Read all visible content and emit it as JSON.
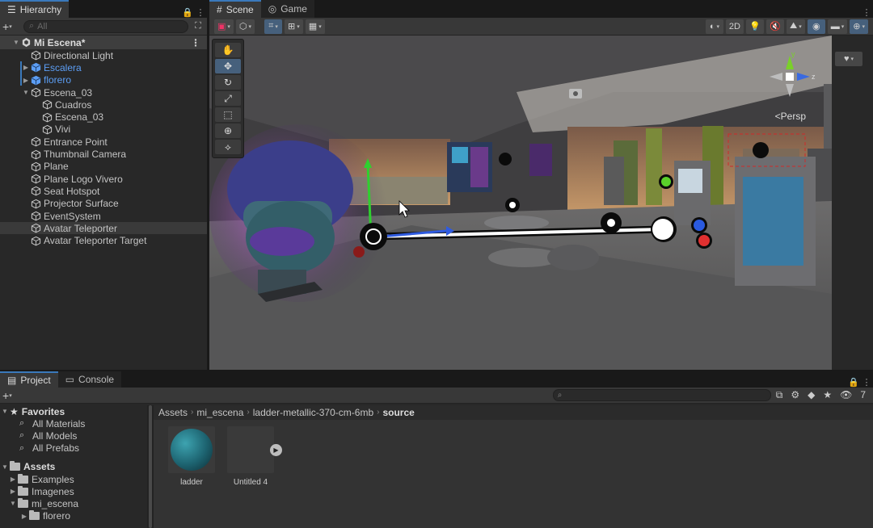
{
  "hierarchy": {
    "tab_label": "Hierarchy",
    "search_placeholder": "All",
    "scene_name": "Mi Escena*",
    "items": [
      {
        "label": "Directional Light"
      },
      {
        "label": "Escalera"
      },
      {
        "label": "florero"
      },
      {
        "label": "Escena_03"
      },
      {
        "label": "Cuadros"
      },
      {
        "label": "Escena_03"
      },
      {
        "label": "Vivi"
      },
      {
        "label": "Entrance Point"
      },
      {
        "label": "Thumbnail Camera"
      },
      {
        "label": "Plane"
      },
      {
        "label": "Plane Logo Vivero"
      },
      {
        "label": "Seat Hotspot"
      },
      {
        "label": "Projector Surface"
      },
      {
        "label": "EventSystem"
      },
      {
        "label": "Avatar Teleporter"
      },
      {
        "label": "Avatar Teleporter Target"
      }
    ]
  },
  "scene": {
    "tabs": [
      {
        "label": "Scene"
      },
      {
        "label": "Game"
      }
    ],
    "toolbar_2d": "2D",
    "persp_label": "Persp",
    "gizmo_axes": {
      "y": "y",
      "z": "z"
    }
  },
  "project": {
    "tabs": [
      {
        "label": "Project"
      },
      {
        "label": "Console"
      }
    ],
    "hidden_count": "7",
    "tree": {
      "favorites": "Favorites",
      "favorites_items": [
        "All Materials",
        "All Models",
        "All Prefabs"
      ],
      "assets": "Assets",
      "assets_items": [
        "Examples",
        "Imagenes",
        "mi_escena",
        "florero"
      ]
    },
    "breadcrumb": [
      "Assets",
      "mi_escena",
      "ladder-metallic-370-cm-6mb",
      "source"
    ],
    "assets": [
      {
        "label": "ladder"
      },
      {
        "label": "Untitled 4"
      }
    ]
  },
  "colors": {
    "accent": "#3a79bb",
    "prefab": "#5c9ef5",
    "panel": "#282828"
  }
}
